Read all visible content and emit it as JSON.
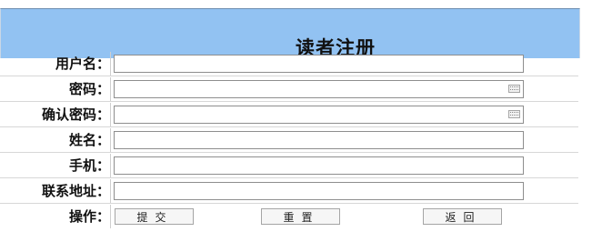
{
  "title": "读者注册",
  "fields": [
    {
      "label": "用户名：",
      "value": "",
      "has_keyboard_icon": false
    },
    {
      "label": "密码：",
      "value": "",
      "has_keyboard_icon": true
    },
    {
      "label": "确认密码：",
      "value": "",
      "has_keyboard_icon": true
    },
    {
      "label": "姓名：",
      "value": "",
      "has_keyboard_icon": false
    },
    {
      "label": "手机：",
      "value": "",
      "has_keyboard_icon": false
    },
    {
      "label": "联系地址：",
      "value": "",
      "has_keyboard_icon": false
    }
  ],
  "actions": {
    "label": "操作：",
    "buttons": [
      "提交",
      "重置",
      "返回"
    ]
  },
  "colors": {
    "title_bar": "#92c2f2",
    "field_border": "#8e8e8e"
  }
}
